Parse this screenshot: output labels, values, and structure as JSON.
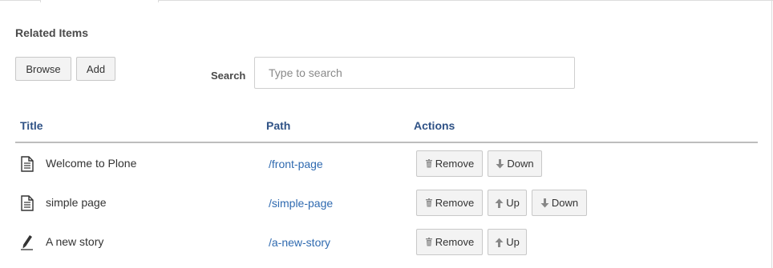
{
  "section_title": "Related Items",
  "toolbar": {
    "browse_label": "Browse",
    "add_label": "Add"
  },
  "search": {
    "label": "Search",
    "placeholder": "Type to search",
    "value": ""
  },
  "table": {
    "columns": [
      "Title",
      "Path",
      "Actions"
    ],
    "rows": [
      {
        "icon": "document-icon",
        "title": "Welcome to Plone",
        "path": "/front-page",
        "actions": [
          "Remove",
          "Down"
        ]
      },
      {
        "icon": "document-icon",
        "title": "simple page",
        "path": "/simple-page",
        "actions": [
          "Remove",
          "Up",
          "Down"
        ]
      },
      {
        "icon": "pencil-icon",
        "title": "A new story",
        "path": "/a-new-story",
        "actions": [
          "Remove",
          "Up"
        ]
      }
    ]
  },
  "colors": {
    "header_text": "#2f5286",
    "link": "#2f6ab0",
    "button_bg": "#f3f3f3",
    "button_border": "#c8c8c8"
  }
}
